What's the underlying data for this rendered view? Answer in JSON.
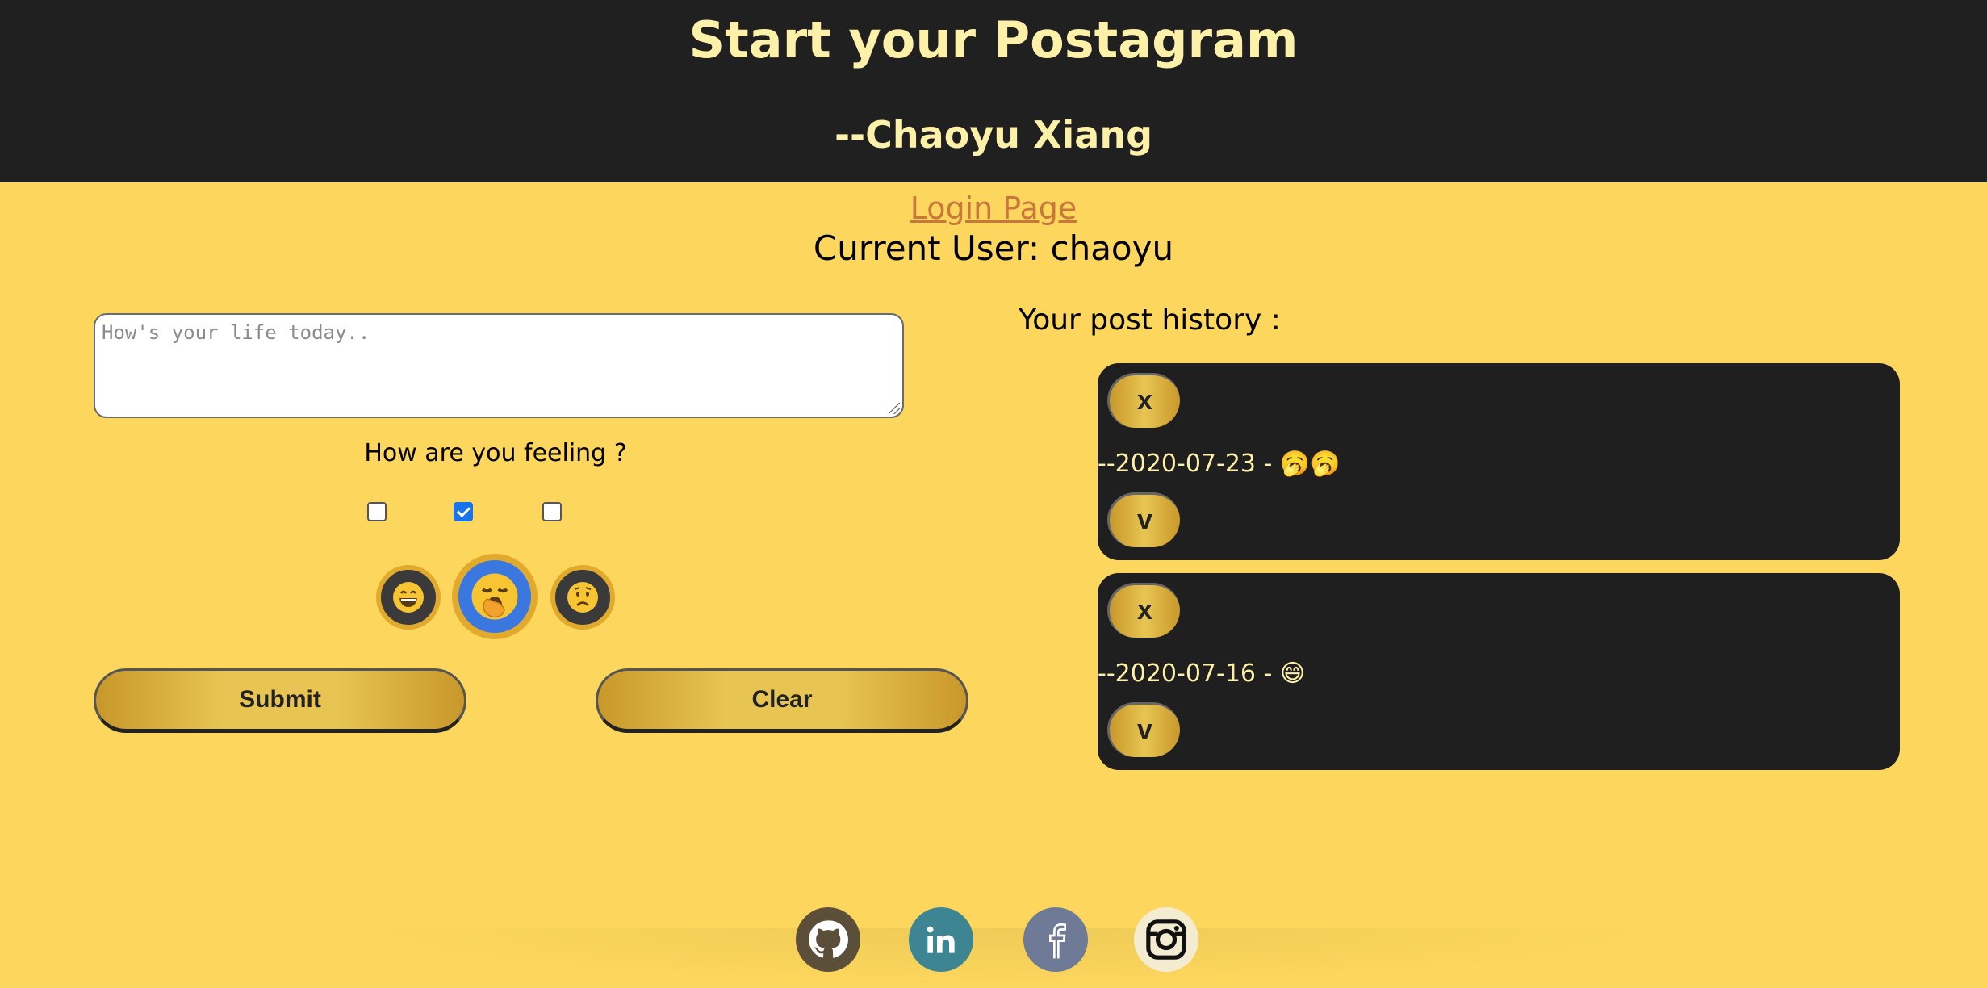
{
  "header": {
    "title": "Start your Postagram",
    "author": "--Chaoyu Xiang"
  },
  "nav": {
    "login_link": "Login Page",
    "current_user": "Current User: chaoyu"
  },
  "composer": {
    "placeholder": "How's your life today..",
    "feeling_label": "How are you feeling ?",
    "moods": [
      {
        "name": "grinning",
        "checked": false
      },
      {
        "name": "yawning",
        "checked": true
      },
      {
        "name": "worried",
        "checked": false
      }
    ],
    "submit_label": "Submit",
    "clear_label": "Clear"
  },
  "history": {
    "label": "Your post history :",
    "posts": [
      {
        "delete_label": "x",
        "date_text": "--2020-07-23 - 🥱🥱",
        "view_label": "v"
      },
      {
        "delete_label": "x",
        "date_text": "--2020-07-16 - 😄",
        "view_label": "v"
      }
    ]
  },
  "footer": {
    "social": [
      {
        "icon": "github-icon",
        "color": "#5b4f3a"
      },
      {
        "icon": "linkedin-icon",
        "color": "#3e8593"
      },
      {
        "icon": "facebook-icon",
        "color": "#6f7a96"
      },
      {
        "icon": "instagram-icon",
        "color": "#f3ecd0"
      }
    ]
  },
  "colors": {
    "background": "#fdd75d",
    "header_bg": "#202020",
    "header_text": "#fdf0a8",
    "link": "#c7783a",
    "card_bg": "#1f1f1f",
    "gold": "#e2aa2c",
    "selected_mood": "#3a78e0"
  }
}
